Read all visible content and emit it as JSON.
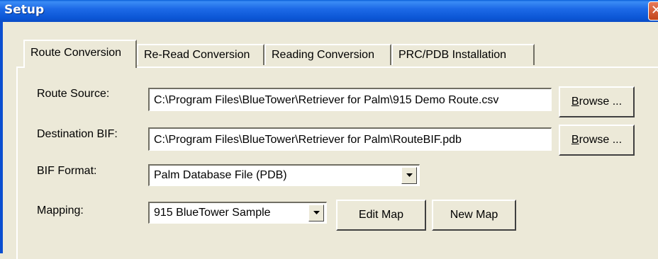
{
  "window": {
    "title": "Setup",
    "close_glyph": "✕"
  },
  "tabs": [
    {
      "label": "Route Conversion",
      "active": true
    },
    {
      "label": "Re-Read Conversion",
      "active": false
    },
    {
      "label": "Reading Conversion",
      "active": false
    },
    {
      "label": "PRC/PDB Installation",
      "active": false
    }
  ],
  "form": {
    "route_source": {
      "label": "Route Source:",
      "value": "C:\\Program Files\\BlueTower\\Retriever for Palm\\915 Demo Route.csv",
      "browse_prefix": "B",
      "browse_rest": "rowse ..."
    },
    "destination_bif": {
      "label": "Destination BIF:",
      "value": "C:\\Program Files\\BlueTower\\Retriever for Palm\\RouteBIF.pdb",
      "browse_prefix": "B",
      "browse_rest": "rowse ..."
    },
    "bif_format": {
      "label": "BIF Format:",
      "selected": "Palm Database File (PDB)"
    },
    "mapping": {
      "label": "Mapping:",
      "selected": "915 BlueTower Sample",
      "edit_label": "Edit Map",
      "new_label": "New Map"
    }
  },
  "icons": {
    "dropdown": "chevron-down-icon",
    "close": "close-icon"
  }
}
